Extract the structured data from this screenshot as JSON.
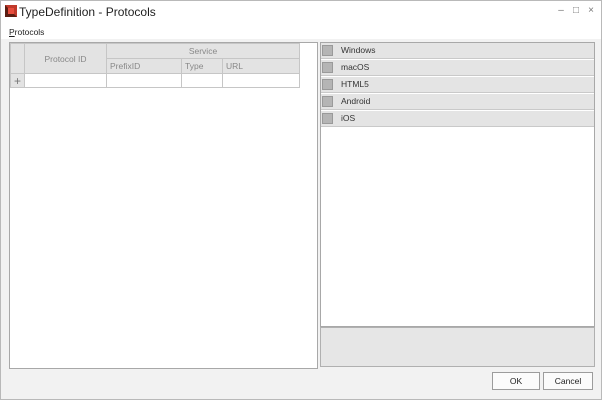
{
  "window": {
    "title": "TypeDefinition - Protocols",
    "minimize_glyph": "–",
    "maximize_glyph": "□",
    "close_glyph": "×"
  },
  "menu": {
    "protocols_accel": "P",
    "protocols_rest": "rotocols"
  },
  "grid": {
    "columns": {
      "protocol_id": "Protocol ID",
      "service": "Service",
      "prefix_id": "PrefixID",
      "type": "Type",
      "url": "URL"
    },
    "add_row_glyph": "+"
  },
  "platforms": [
    {
      "label": "Windows",
      "checked": false
    },
    {
      "label": "macOS",
      "checked": false
    },
    {
      "label": "HTML5",
      "checked": false
    },
    {
      "label": "Android",
      "checked": false
    },
    {
      "label": "iOS",
      "checked": false
    }
  ],
  "buttons": {
    "ok": "OK",
    "cancel": "Cancel"
  },
  "icons": {
    "app": "typedefinition-app-icon"
  }
}
